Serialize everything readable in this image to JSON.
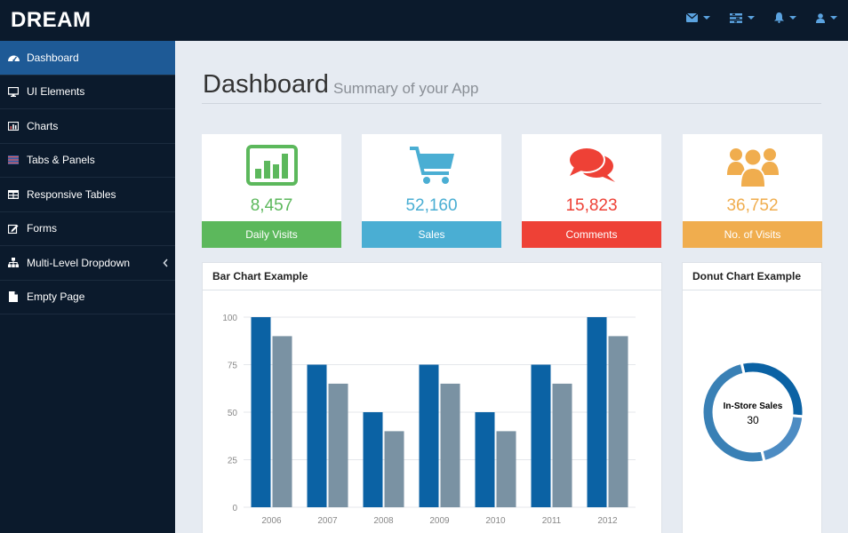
{
  "brand": "DREAM",
  "topbar": {
    "icons": [
      "envelope-icon",
      "tasks-icon",
      "bell-icon",
      "user-icon"
    ]
  },
  "sidebar": {
    "items": [
      {
        "label": "Dashboard",
        "icon": "dashboard-icon",
        "active": true
      },
      {
        "label": "UI Elements",
        "icon": "desktop-icon"
      },
      {
        "label": "Charts",
        "icon": "bar-chart-icon"
      },
      {
        "label": "Tabs & Panels",
        "icon": "flag-icon"
      },
      {
        "label": "Responsive Tables",
        "icon": "table-icon"
      },
      {
        "label": "Forms",
        "icon": "edit-icon"
      },
      {
        "label": "Multi-Level Dropdown",
        "icon": "sitemap-icon",
        "has_children": true
      },
      {
        "label": "Empty Page",
        "icon": "file-icon"
      }
    ]
  },
  "header": {
    "title": "Dashboard",
    "subtitle": "Summary of your App"
  },
  "stats": [
    {
      "value": "8,457",
      "label": "Daily Visits",
      "color": "#5cb85c",
      "icon": "bar-chart-icon"
    },
    {
      "value": "52,160",
      "label": "Sales",
      "color": "#4aaed3",
      "icon": "shopping-cart-icon"
    },
    {
      "value": "15,823",
      "label": "Comments",
      "color": "#ee4136",
      "icon": "comments-icon"
    },
    {
      "value": "36,752",
      "label": "No. of Visits",
      "color": "#f0ad4e",
      "icon": "users-icon"
    }
  ],
  "bar_panel": {
    "title": "Bar Chart Example"
  },
  "donut_panel": {
    "title": "Donut Chart Example"
  },
  "chart_data": [
    {
      "type": "bar",
      "title": "Bar Chart Example",
      "categories": [
        "2006",
        "2007",
        "2008",
        "2009",
        "2010",
        "2011",
        "2012"
      ],
      "series": [
        {
          "values": [
            100,
            75,
            50,
            75,
            50,
            75,
            100
          ],
          "color": "#0b62a4"
        },
        {
          "values": [
            90,
            65,
            40,
            65,
            40,
            65,
            90
          ],
          "color": "#7a92a3"
        }
      ],
      "ylim": [
        0,
        100
      ],
      "yticks": [
        0,
        25,
        50,
        75,
        100
      ],
      "grid": true
    },
    {
      "type": "pie",
      "title": "Donut Chart Example",
      "center_label": "In-Store Sales",
      "center_value": "30",
      "slices": [
        {
          "value": 30,
          "color": "#0b62a4",
          "label": "In-Store Sales"
        },
        {
          "value": 20,
          "color": "#4d8cc3"
        },
        {
          "value": 50,
          "color": "#3980b5"
        }
      ]
    }
  ]
}
